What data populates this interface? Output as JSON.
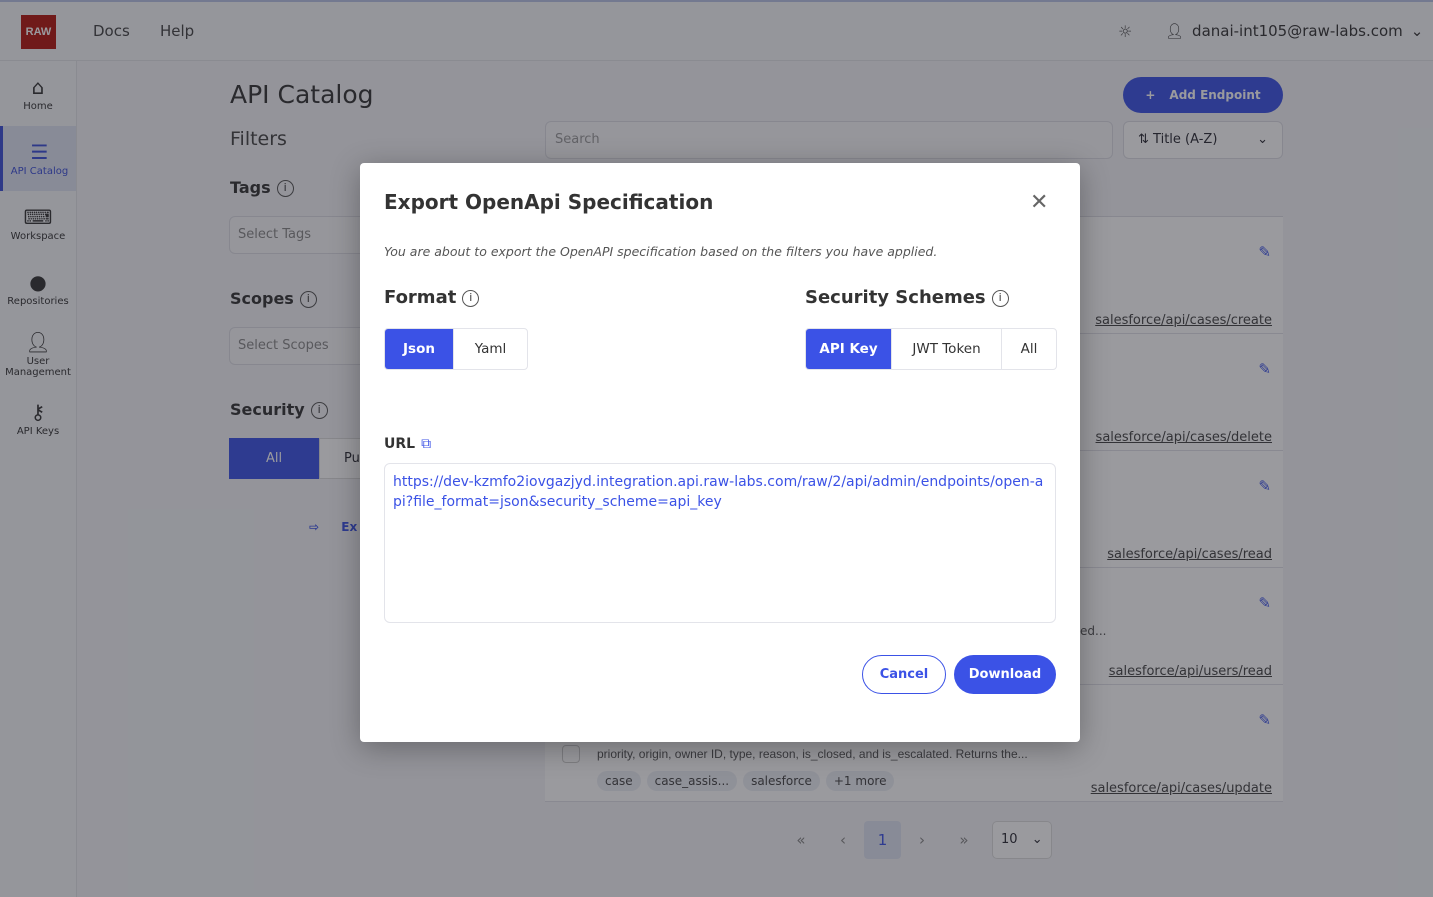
{
  "header": {
    "logo": "RAW",
    "nav": [
      "Docs",
      "Help"
    ],
    "user": "danai-int105@raw-labs.com"
  },
  "sidebar": {
    "items": [
      {
        "label": "Home",
        "icon": "home-icon"
      },
      {
        "label": "API Catalog",
        "icon": "catalog-icon",
        "active": true
      },
      {
        "label": "Workspace",
        "icon": "workspace-icon"
      },
      {
        "label": "Repositories",
        "icon": "github-icon"
      },
      {
        "label": "User Management",
        "icon": "user-shield-icon"
      },
      {
        "label": "API Keys",
        "icon": "key-icon"
      }
    ]
  },
  "page": {
    "title": "API Catalog",
    "filters": "Filters",
    "tags_label": "Tags",
    "tags_placeholder": "Select Tags",
    "scopes_label": "Scopes",
    "scopes_placeholder": "Select Scopes",
    "security_label": "Security",
    "security_options": [
      "All",
      "Pu"
    ],
    "export_label": "Ex",
    "search_placeholder": "Search",
    "sort": "Title (A-Z)",
    "add_endpoint": "Add Endpoint"
  },
  "cards": [
    {
      "link": "salesforce/api/cases/create"
    },
    {
      "link": "salesforce/api/cases/delete"
    },
    {
      "link": "salesforce/api/cases/read"
    },
    {
      "link": "salesforce/api/users/read",
      "desc": "ed..."
    },
    {
      "link": "salesforce/api/cases/update",
      "desc": "priority, origin, owner ID, type, reason, is_closed, and is_escalated. Returns the...",
      "tags": [
        "case",
        "case_assis...",
        "salesforce",
        "+1 more"
      ]
    }
  ],
  "pagination": {
    "current": "1",
    "per_page": "10"
  },
  "modal": {
    "title": "Export OpenApi Specification",
    "subtitle": "You are about to export the OpenAPI specification based on the filters you have applied.",
    "format_label": "Format",
    "formats": [
      "Json",
      "Yaml"
    ],
    "format_selected": "Json",
    "security_label": "Security Schemes",
    "schemes": [
      "API Key",
      "JWT Token",
      "All"
    ],
    "scheme_selected": "API Key",
    "url_label": "URL",
    "url": "https://dev-kzmfo2iovgazjyd.integration.api.raw-labs.com/raw/2/api/admin/endpoints/open-api?file_format=json&security_scheme=api_key",
    "cancel": "Cancel",
    "download": "Download"
  },
  "colors": {
    "accent": "#3b52e6",
    "logo": "#b3160f"
  }
}
